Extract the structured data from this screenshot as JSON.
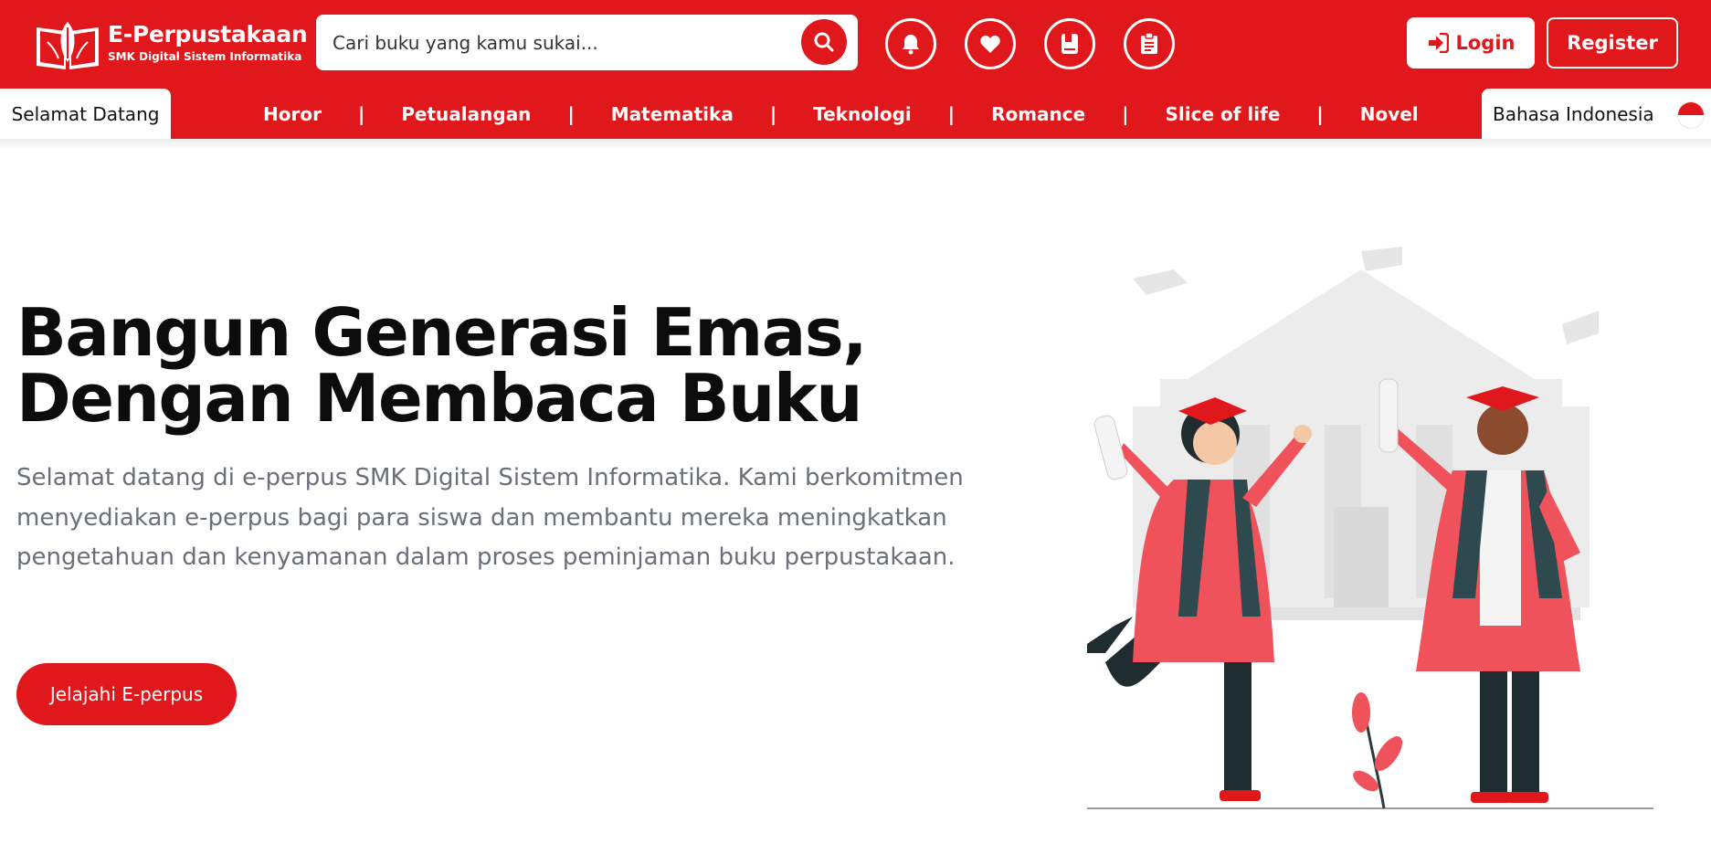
{
  "header": {
    "logo": {
      "title": "E-Perpustakaan",
      "subtitle": "SMK Digital Sistem Informatika",
      "icon": "book-leaf-logo"
    },
    "search": {
      "placeholder": "Cari buku yang kamu sukai...",
      "value": "",
      "icon": "search-icon"
    },
    "icons": [
      {
        "name": "bell-icon"
      },
      {
        "name": "heart-icon"
      },
      {
        "name": "book-icon"
      },
      {
        "name": "clipboard-icon"
      }
    ],
    "login_label": "Login",
    "register_label": "Register"
  },
  "nav": {
    "welcome": "Selamat Datang",
    "categories": [
      "Horor",
      "Petualangan",
      "Matematika",
      "Teknologi",
      "Romance",
      "Slice of life",
      "Novel"
    ],
    "separator": "|",
    "language": "Bahasa Indonesia"
  },
  "hero": {
    "title_line1": "Bangun Generasi Emas,",
    "title_line2": "Dengan Membaca Buku",
    "description": "Selamat datang di e-perpus SMK Digital Sistem Informatika. Kami berkomitmen menyediakan e-perpus bagi para siswa dan membantu mereka meningkatkan pengetahuan dan kenyamanan dalam proses peminjaman buku perpustakaan.",
    "cta_label": "Jelajahi E-perpus"
  },
  "colors": {
    "primary": "#e0181b",
    "text_muted": "#6b6f7a",
    "white": "#ffffff"
  }
}
